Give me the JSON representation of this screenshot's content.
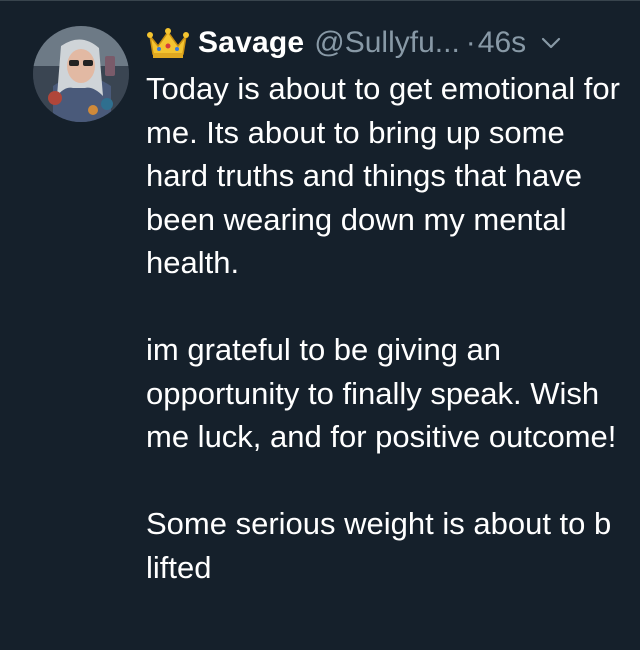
{
  "tweet": {
    "display_name": "Savage",
    "handle": "@Sullyfu...",
    "separator": "·",
    "timestamp": "46s",
    "badge_icon": "crown-icon",
    "menu_icon": "chevron-down-icon",
    "avatar": "avatar",
    "paragraphs": [
      "Today is about to get emotional for me. Its about to bring up some hard truths and things that have been wearing down my mental health.",
      "im grateful to be giving an opportunity to finally speak. Wish me luck, and for positive outcome!",
      "Some serious weight is about to b lifted"
    ]
  },
  "colors": {
    "background": "#15202b",
    "text": "#ffffff",
    "secondary_text": "#8899a6",
    "crown": "#f4c430"
  }
}
